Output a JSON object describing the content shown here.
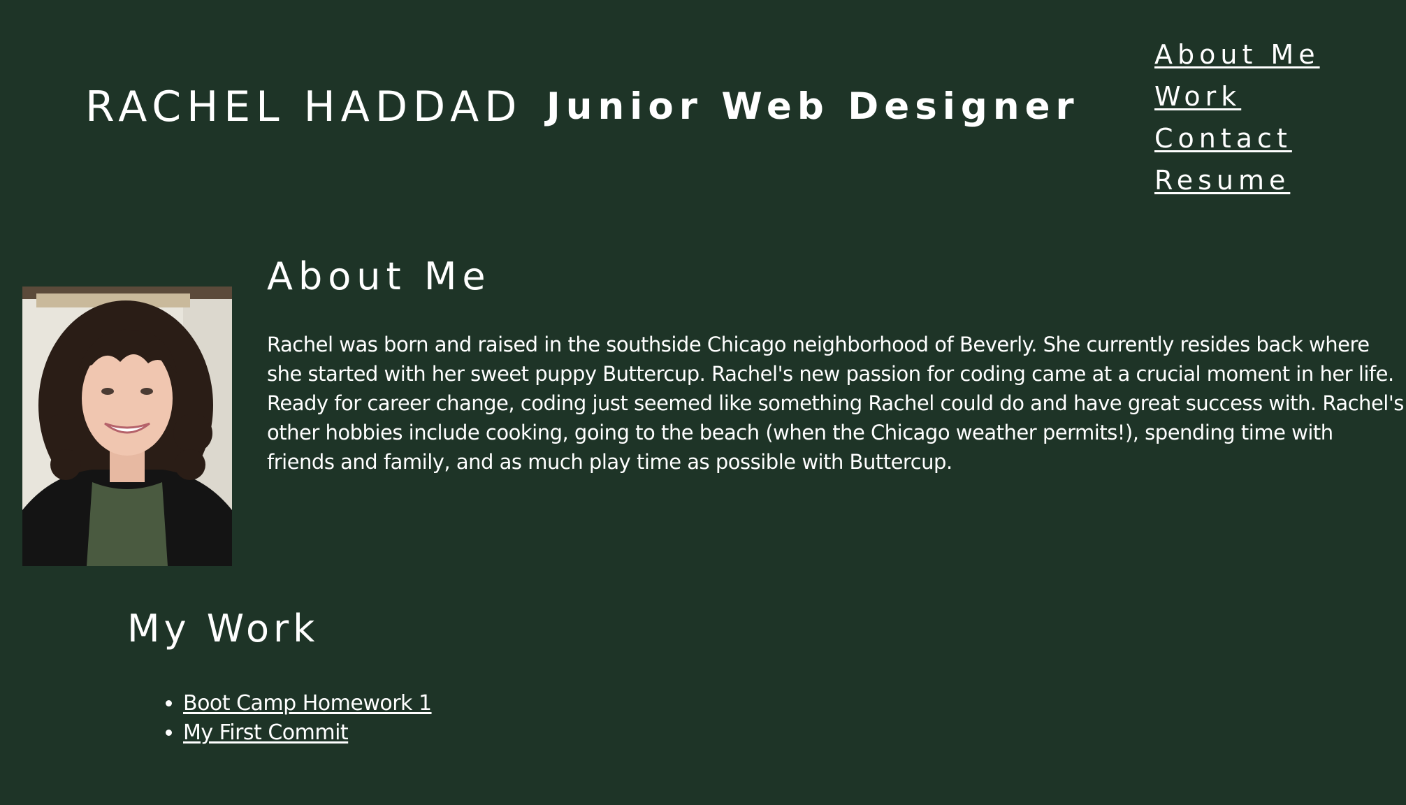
{
  "header": {
    "name": "RACHEL HADDAD",
    "tagline": "Junior Web Designer"
  },
  "nav": {
    "items": [
      {
        "label": "About Me"
      },
      {
        "label": "Work"
      },
      {
        "label": "Contact"
      },
      {
        "label": "Resume"
      }
    ]
  },
  "about": {
    "title": "About Me",
    "text": "Rachel was born and raised in the southside Chicago neighborhood of  Beverly. She currently resides back where she started with her sweet puppy  Buttercup.  Rachel's new passion for coding came at a crucial moment in her life.  Ready for career change, coding just seemed like something  Rachel could do and have great success with.  Rachel's other hobbies include cooking, going to the beach (when the Chicago weather permits!), spending time with friends and family, and as much play time as possible with  Buttercup."
  },
  "work": {
    "title": "My Work",
    "links": [
      {
        "label": "Boot Camp  Homework 1"
      },
      {
        "label": "My  First Commit"
      }
    ]
  },
  "colors": {
    "background": "#1e3427",
    "text": "#ffffff"
  }
}
